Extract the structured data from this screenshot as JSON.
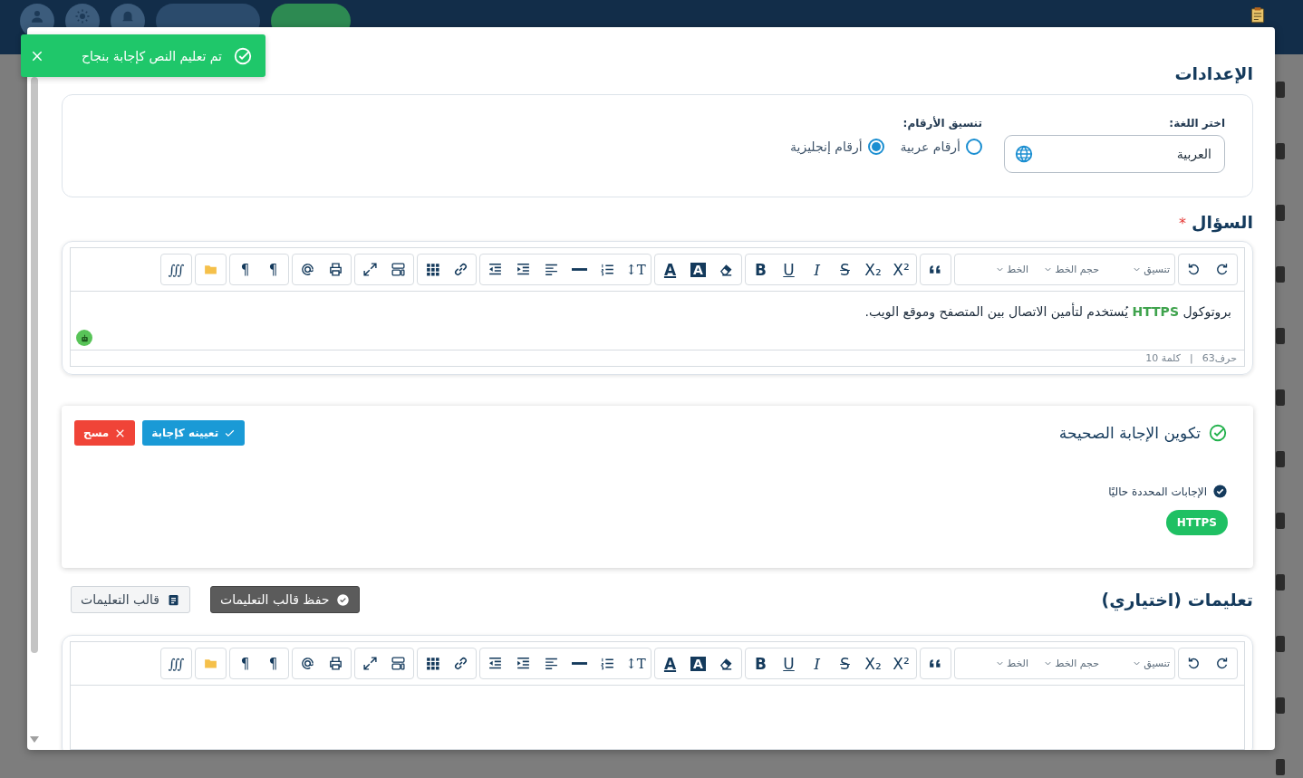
{
  "toast": {
    "message": "تم تعليم النص كإجابة بنجاح"
  },
  "settings": {
    "title": "الإعدادات",
    "language": {
      "label": "اختر اللغة:",
      "value": "العربية"
    },
    "numbers": {
      "label": "تنسيق الأرقام:",
      "options": [
        {
          "label": "أرقام عربية",
          "selected": false
        },
        {
          "label": "أرقام إنجليزية",
          "selected": true
        }
      ]
    }
  },
  "question": {
    "label": "السؤال",
    "required_mark": "*",
    "editor": {
      "toolbar": [
        [
          {
            "kind": "redo"
          },
          {
            "kind": "undo"
          }
        ],
        [
          {
            "kind": "dropdown",
            "label": "تنسيق"
          },
          {
            "kind": "dropdown",
            "label": "حجم الخط"
          },
          {
            "kind": "dropdown",
            "label": "الخط"
          }
        ],
        [
          {
            "kind": "quote"
          }
        ],
        [
          {
            "kind": "superscript",
            "label": "X²"
          },
          {
            "kind": "subscript",
            "label": "X₂"
          },
          {
            "kind": "strike",
            "label": "S"
          },
          {
            "kind": "italic",
            "label": "I"
          },
          {
            "kind": "underline",
            "label": "U"
          },
          {
            "kind": "bold",
            "label": "B"
          }
        ],
        [
          {
            "kind": "eraser"
          },
          {
            "kind": "highlight",
            "label": "A"
          },
          {
            "kind": "text-color",
            "label": "A"
          }
        ],
        [
          {
            "kind": "text-size",
            "label": "T↕"
          },
          {
            "kind": "numbered-list"
          },
          {
            "kind": "horizontal-line"
          },
          {
            "kind": "align"
          },
          {
            "kind": "indent"
          },
          {
            "kind": "outdent"
          }
        ],
        [
          {
            "kind": "link"
          },
          {
            "kind": "table"
          }
        ],
        [
          {
            "kind": "layout"
          },
          {
            "kind": "fullscreen"
          }
        ],
        [
          {
            "kind": "print"
          },
          {
            "kind": "mention"
          }
        ],
        [
          {
            "kind": "paragraph",
            "label": "¶"
          },
          {
            "kind": "paragraph",
            "label": "¶"
          }
        ],
        [
          {
            "kind": "folder"
          }
        ],
        [
          {
            "kind": "math",
            "label": "∭"
          }
        ]
      ],
      "content": "بروتوكول **HTTPS**  يُستخدم لتأمين الاتصال بين المتصفح وموقع الويب.",
      "assistant": true,
      "counts": {
        "chars": "حرف63",
        "separator": "|",
        "words": "كلمة 10"
      }
    }
  },
  "answer": {
    "title": "تكوين الإجابة الصحيحة",
    "buttons": [
      {
        "label": "تعيينه كإجابة",
        "kind": "assign"
      },
      {
        "label": "مسح",
        "kind": "clear"
      }
    ],
    "current_label": "الإجابات المحددة حاليًا",
    "chips": [
      "HTTPS"
    ]
  },
  "instructions": {
    "title": "تعليمات (اختياري)",
    "buttons": [
      {
        "label": "حفظ قالب التعليمات",
        "kind": "save"
      },
      {
        "label": "قالب التعليمات",
        "kind": "template"
      }
    ],
    "editor": {
      "toolbar": [
        [
          {
            "kind": "redo"
          },
          {
            "kind": "undo"
          }
        ],
        [
          {
            "kind": "dropdown",
            "label": "تنسيق"
          },
          {
            "kind": "dropdown",
            "label": "حجم الخط"
          },
          {
            "kind": "dropdown",
            "label": "الخط"
          }
        ],
        [
          {
            "kind": "quote"
          }
        ],
        [
          {
            "kind": "superscript",
            "label": "X²"
          },
          {
            "kind": "subscript",
            "label": "X₂"
          },
          {
            "kind": "strike",
            "label": "S"
          },
          {
            "kind": "italic",
            "label": "I"
          },
          {
            "kind": "underline",
            "label": "U"
          },
          {
            "kind": "bold",
            "label": "B"
          }
        ],
        [
          {
            "kind": "eraser"
          },
          {
            "kind": "highlight",
            "label": "A"
          },
          {
            "kind": "text-color",
            "label": "A"
          }
        ],
        [
          {
            "kind": "text-size",
            "label": "T↕"
          },
          {
            "kind": "numbered-list"
          },
          {
            "kind": "horizontal-line"
          },
          {
            "kind": "align"
          },
          {
            "kind": "indent"
          },
          {
            "kind": "outdent"
          }
        ],
        [
          {
            "kind": "link"
          },
          {
            "kind": "table"
          }
        ],
        [
          {
            "kind": "layout"
          },
          {
            "kind": "fullscreen"
          }
        ],
        [
          {
            "kind": "print"
          },
          {
            "kind": "mention"
          }
        ],
        [
          {
            "kind": "paragraph",
            "label": "¶"
          },
          {
            "kind": "paragraph",
            "label": "¶"
          }
        ],
        [
          {
            "kind": "folder"
          }
        ],
        [
          {
            "kind": "math",
            "label": "∭"
          }
        ]
      ],
      "assistant": false
    }
  }
}
